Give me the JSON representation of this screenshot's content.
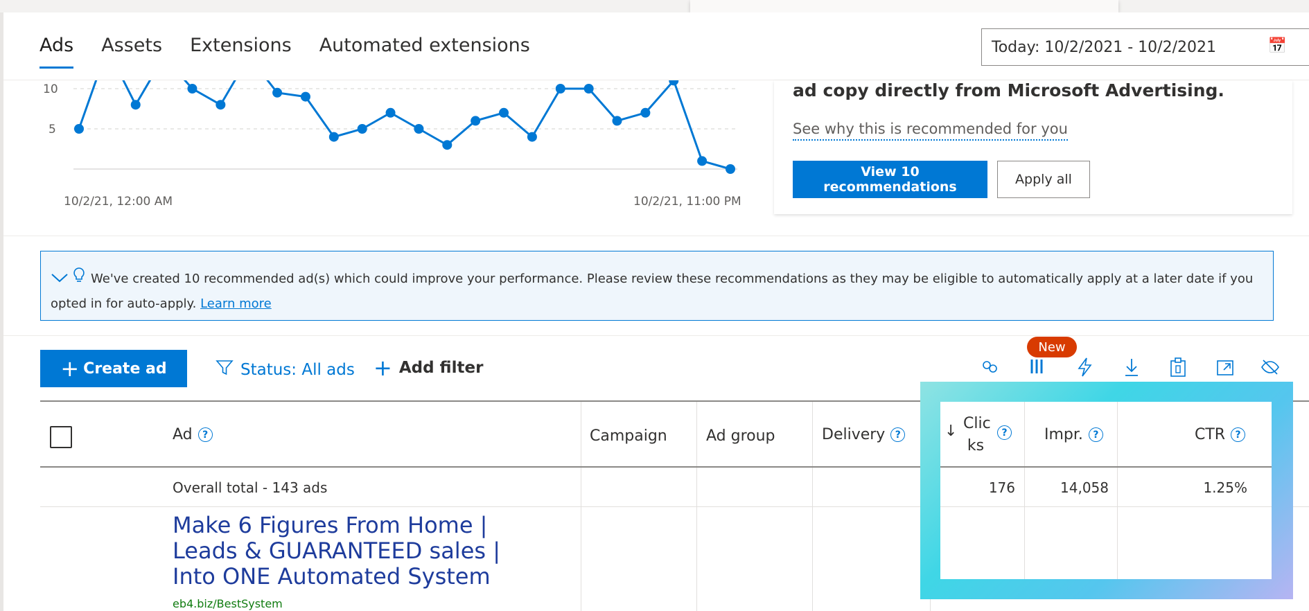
{
  "tabs": [
    {
      "label": "Ads",
      "active": true
    },
    {
      "label": "Assets",
      "active": false
    },
    {
      "label": "Extensions",
      "active": false
    },
    {
      "label": "Automated extensions",
      "active": false
    }
  ],
  "date_range": {
    "label": "Today: 10/2/2021 - 10/2/2021",
    "icon": "calendar-icon"
  },
  "chart": {
    "y_ticks": [
      "10",
      "5"
    ],
    "x_labels": [
      "10/2/21, 12:00 AM",
      "10/2/21, 11:00 PM"
    ],
    "series_color": "#0078d4",
    "values": [
      5,
      15,
      8,
      14,
      10,
      8,
      14,
      9.5,
      9,
      4,
      5,
      7,
      5,
      3,
      6,
      7,
      4,
      10,
      10,
      6,
      7,
      11,
      1,
      0
    ]
  },
  "recommendation": {
    "headline": "ad copy directly from Microsoft Advertising.",
    "why_link": "See why this is recommended for you",
    "primary_button": "View 10 recommendations",
    "secondary_button": "Apply all"
  },
  "banner": {
    "text": "We've created 10 recommended ad(s) which could improve your performance. Please review these recommendations as they may be eligible to automatically apply at a later date if you opted in for auto-apply.",
    "link": "Learn more"
  },
  "toolbar": {
    "create_label": "Create ad",
    "status_filter": "Status: All ads",
    "add_filter": "Add filter",
    "new_badge": "New",
    "brand_color": "#0078d4"
  },
  "table": {
    "headers": {
      "ad": "Ad",
      "campaign": "Campaign",
      "ad_group": "Ad group",
      "delivery": "Delivery",
      "clicks": "Clic ks",
      "impr": "Impr.",
      "ctr": "CTR"
    },
    "total_row": {
      "label": "Overall total - 143 ads",
      "clicks": "176",
      "impr": "14,058",
      "ctr": "1.25%"
    },
    "rows": [
      {
        "title": "Make 6 Figures From Home | Leads & GUARANTEED sales | Into ONE Automated System",
        "url": "eb4.biz/BestSystem"
      }
    ]
  }
}
